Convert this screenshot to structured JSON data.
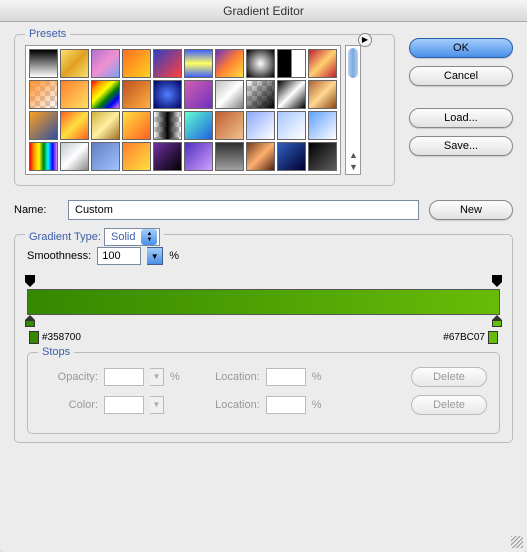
{
  "title": "Gradient Editor",
  "presets": {
    "legend": "Presets",
    "swatches": [
      "linear-gradient(#000,#fff)",
      "linear-gradient(135deg,#f8e070,#e0a020,#f8e070)",
      "linear-gradient(135deg,#b070d0,#f090d0,#80a0f0)",
      "linear-gradient(135deg,#ff7020,#ffd020)",
      "linear-gradient(135deg,#3040c0,#ff4040)",
      "linear-gradient(#4060ff,#ffff60,#4060ff)",
      "linear-gradient(135deg,#7030c0,#ff8030,#ffe040)",
      "radial-gradient(#fff,#000)",
      "linear-gradient(to right,#000,#000 50%,#fff 50%,#fff)",
      "linear-gradient(135deg,#c02030,#ffd070,#c02030)",
      "linear-gradient(135deg,#ff9030,rgba(255,255,255,0))",
      "linear-gradient(135deg,#ff8030,#ffe060)",
      "linear-gradient(135deg,red,orange,yellow,green,blue,violet)",
      "linear-gradient(135deg,#c05020,#ffb040)",
      "radial-gradient(#5080ff,#000060)",
      "linear-gradient(135deg,#d060b0,#7030c0)",
      "linear-gradient(135deg,#c0c0c0,#fff,#808080)",
      "linear-gradient(135deg,rgba(0,0,0,0),#000)",
      "linear-gradient(135deg,#000,#fff,#000)",
      "linear-gradient(135deg,#b06030,#ffd890,#8b4513)",
      "linear-gradient(135deg,#ffa020,#3050a0)",
      "linear-gradient(135deg,#ff6020,#ffe040,#ff6020)",
      "linear-gradient(135deg,#d0b040,#fff0a0,#a07020)",
      "linear-gradient(135deg,#ffe040,#ff6020)",
      "linear-gradient(to right,rgba(0,0,0,0),#000,rgba(0,0,0,0))",
      "linear-gradient(135deg,#60ffd0,#2060e0)",
      "linear-gradient(135deg,#c06030,#f0c090)",
      "linear-gradient(135deg,#8ba8ff,#fff)",
      "linear-gradient(135deg,#a8c8ff,#fff)",
      "linear-gradient(135deg,#60a0ff,#fff)",
      "linear-gradient(to right,red,orange,yellow,green,cyan,blue,violet)",
      "linear-gradient(135deg,#c0c8d0,#fff,#888)",
      "linear-gradient(135deg,#6080c0,#a0c0ff)",
      "linear-gradient(135deg,#ff8030,#ffe040)",
      "linear-gradient(135deg,#7030a0,#000)",
      "linear-gradient(135deg,#5030c0,#d0a0ff)",
      "linear-gradient(#303030,#a0a0a0)",
      "linear-gradient(135deg,#704020,#ffb070,#502010)",
      "linear-gradient(135deg,#3060c0,#000030)",
      "linear-gradient(135deg,#000,#606060)"
    ]
  },
  "buttons": {
    "ok": "OK",
    "cancel": "Cancel",
    "load": "Load...",
    "save": "Save...",
    "new": "New",
    "delete": "Delete"
  },
  "name": {
    "label": "Name:",
    "value": "Custom"
  },
  "gradientType": {
    "label": "Gradient Type:",
    "value": "Solid"
  },
  "smoothness": {
    "label": "Smoothness:",
    "value": "100",
    "unit": "%"
  },
  "gradient": {
    "startColor": "#358700",
    "endColor": "#67BC07",
    "startHex": "#358700",
    "endHex": "#67BC07"
  },
  "stops": {
    "legend": "Stops",
    "opacity": "Opacity:",
    "color": "Color:",
    "location": "Location:",
    "pct": "%"
  }
}
